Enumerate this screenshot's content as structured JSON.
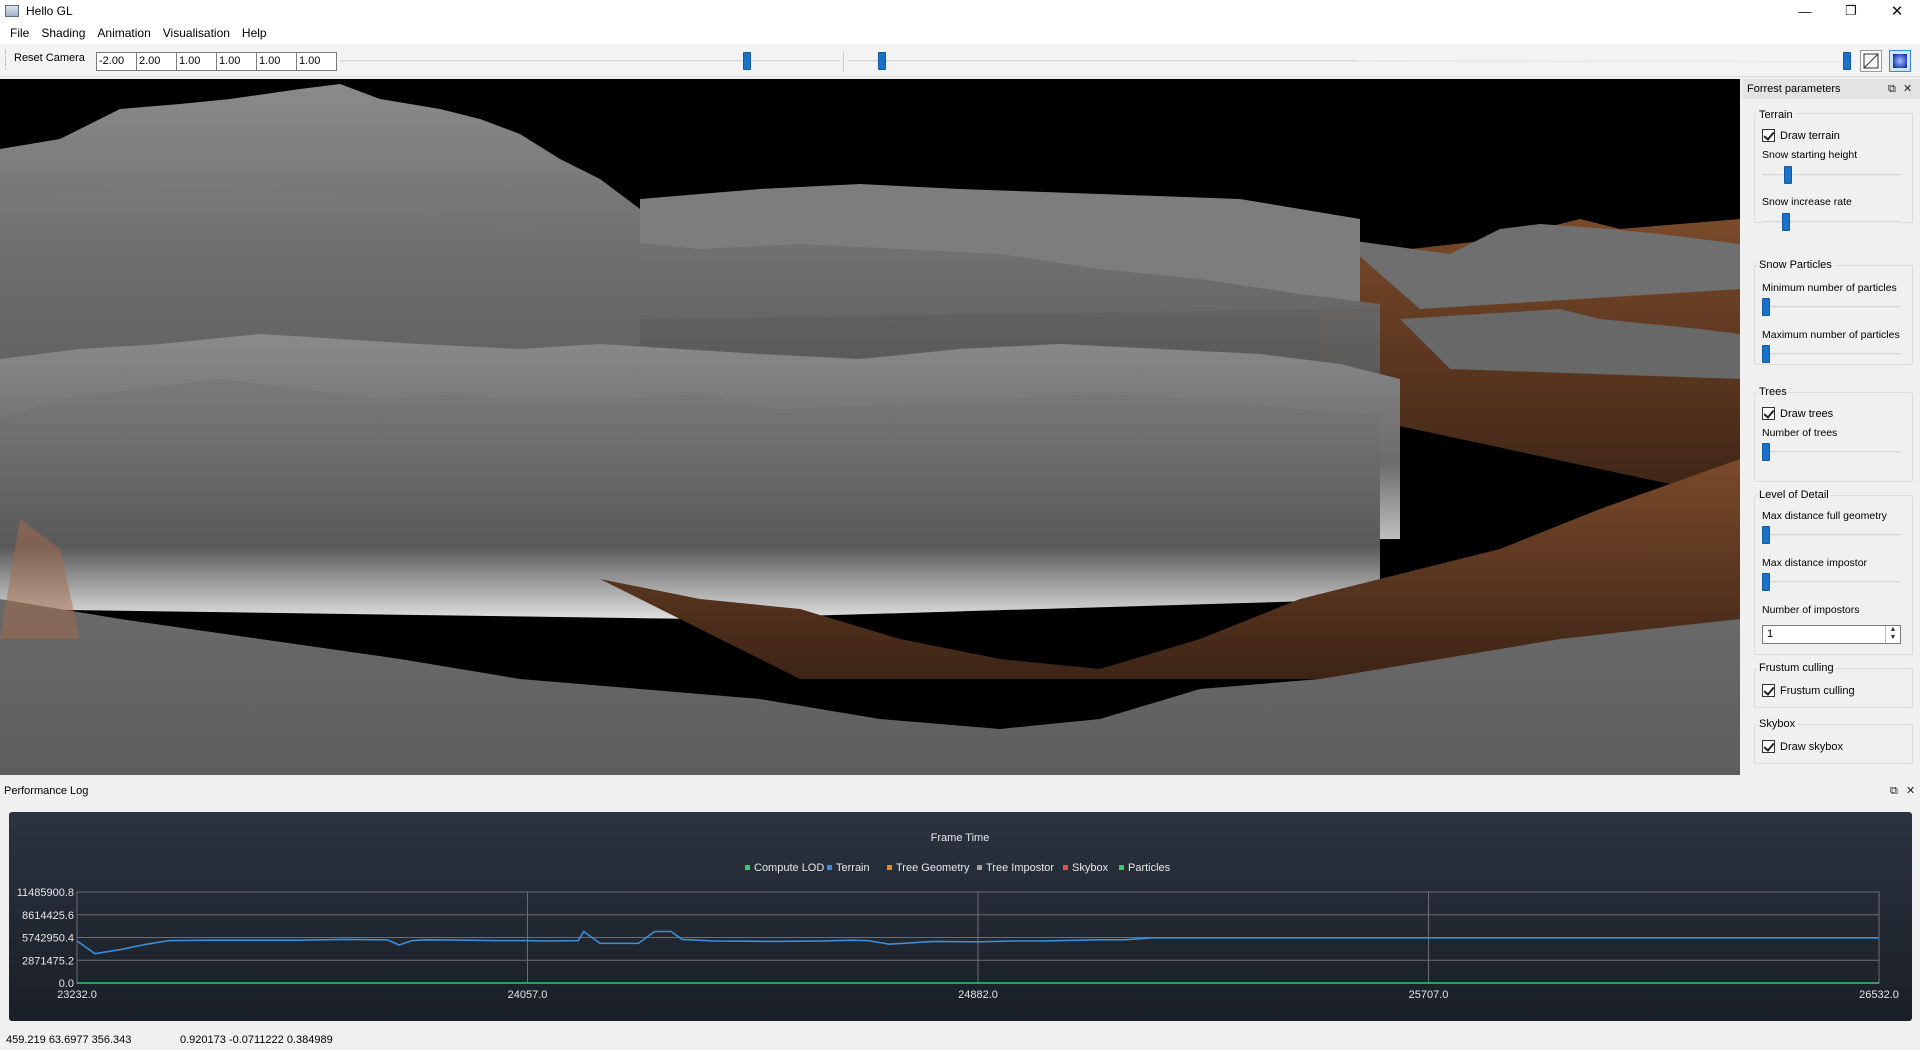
{
  "window": {
    "title": "Hello GL",
    "minimize_icon": "minimize-icon",
    "restore_icon": "restore-icon",
    "close_icon": "close-icon"
  },
  "menu": [
    "File",
    "Shading",
    "Animation",
    "Visualisation",
    "Help"
  ],
  "toolbar": {
    "reset_camera": "Reset Camera",
    "camera_values": [
      "-2.00",
      "2.00",
      "1.00",
      "1.00",
      "1.00",
      "1.00"
    ],
    "sliders": [
      0.82,
      0.03,
      0.99
    ],
    "buttons": [
      "wireframe-toggle-icon",
      "shaded-render-icon"
    ]
  },
  "forest_panel": {
    "title": "Forrest parameters",
    "terrain": {
      "title": "Terrain",
      "draw_terrain": "Draw terrain",
      "snow_height_label": "Snow starting height",
      "snow_height": 0.17,
      "snow_rate_label": "Snow increase rate",
      "snow_rate": 0.15
    },
    "snow_particles": {
      "title": "Snow Particles",
      "min_label": "Minimum number of particles",
      "min": 0.0,
      "max_label": "Maximum number of particles",
      "max": 0.0
    },
    "trees": {
      "title": "Trees",
      "draw_trees": "Draw trees",
      "count_label": "Number of trees",
      "count": 0.0
    },
    "lod": {
      "title": "Level of Detail",
      "full_label": "Max distance full geometry",
      "full": 0.0,
      "impostor_label": "Max distance impostor",
      "impostor": 0.0,
      "num_impostors_label": "Number of impostors",
      "num_impostors": "1"
    },
    "frustum": {
      "title": "Frustum culling",
      "label": "Frustum culling"
    },
    "skybox": {
      "title": "Skybox",
      "label": "Draw skybox"
    }
  },
  "perf_panel": {
    "title": "Performance Log"
  },
  "chart_data": {
    "type": "line",
    "title": "Frame Time",
    "legend": [
      {
        "name": "Compute LOD",
        "color": "#3ec46d"
      },
      {
        "name": "Terrain",
        "color": "#3b8fd9"
      },
      {
        "name": "Tree Geometry",
        "color": "#e58a2c"
      },
      {
        "name": "Tree Impostor",
        "color": "#a0a0a0"
      },
      {
        "name": "Skybox",
        "color": "#d9534f"
      },
      {
        "name": "Particles",
        "color": "#3ec46d"
      }
    ],
    "legend_placement": "top",
    "yticks": [
      "11485900.8",
      "8614425.6",
      "5742950.4",
      "2871475.2",
      "0.0"
    ],
    "xticks": [
      "23232.0",
      "24057.0",
      "24882.0",
      "25707.0",
      "26532.0"
    ],
    "xlim": [
      23232,
      26532
    ],
    "ylim": [
      0,
      11485900.8
    ],
    "grid": true,
    "series": [
      {
        "name": "Terrain",
        "color": "#3b8fd9",
        "x": [
          23232,
          23265,
          23310,
          23360,
          23400,
          23480,
          23560,
          23640,
          23720,
          23800,
          23822,
          23845,
          23870,
          23950,
          24000,
          24057,
          24090,
          24150,
          24160,
          24190,
          24210,
          24260,
          24290,
          24320,
          24340,
          24400,
          24500,
          24600,
          24650,
          24680,
          24720,
          24800,
          24882,
          24950,
          25000,
          25100,
          25150,
          25200,
          25350,
          25550,
          25707,
          25900,
          26100,
          26300,
          26532
        ],
        "y": [
          5300000,
          3700000,
          4200000,
          4900000,
          5350000,
          5400000,
          5400000,
          5400000,
          5500000,
          5450000,
          4800000,
          5350000,
          5450000,
          5400000,
          5350000,
          5350000,
          5300000,
          5350000,
          6500000,
          5000000,
          5000000,
          5000000,
          6500000,
          6500000,
          5500000,
          5300000,
          5250000,
          5300000,
          5400000,
          5350000,
          4900000,
          5250000,
          5200000,
          5300000,
          5300000,
          5450000,
          5450000,
          5700000,
          5700000,
          5700000,
          5700000,
          5700000,
          5700000,
          5700000,
          5700000
        ]
      },
      {
        "name": "Compute LOD",
        "color": "#3ec46d",
        "x": [
          23232,
          26532
        ],
        "y": [
          0,
          0
        ]
      }
    ]
  },
  "status": {
    "position": "459.219 63.6977 356.343",
    "direction": "0.920173 -0.0711222 0.384989"
  }
}
